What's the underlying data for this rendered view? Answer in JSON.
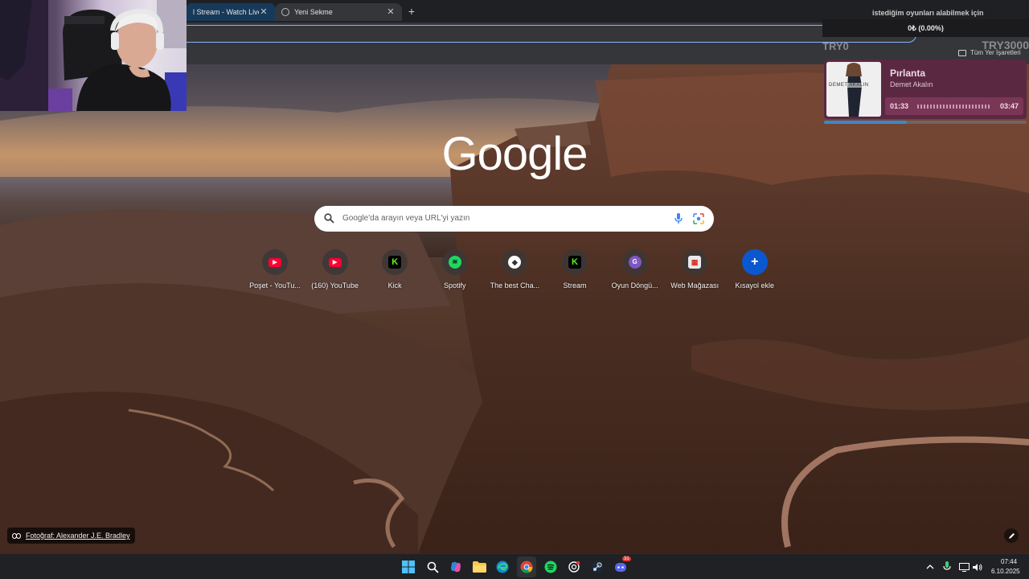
{
  "browser": {
    "tabs": [
      {
        "title": "l Stream - Watch Live o",
        "active": false
      },
      {
        "title": "Yeni Sekme",
        "active": true
      }
    ],
    "new_tab_symbol": "+",
    "close_symbol": "✕",
    "bookmarks_all_label": "Tüm Yer İşaretleri"
  },
  "stream_overlay": {
    "goal_text": "istediğim oyunları alabilmek için",
    "goal_progress": "0₺ (0.00%)",
    "goal_min_label": "TRY0",
    "goal_max_label": "TRY3000",
    "goal_fraction": 0.0
  },
  "music": {
    "title": "Pırlanta",
    "artist": "Demet Akalın",
    "elapsed": "01:33",
    "total": "03:47",
    "progress": 0.41,
    "album_text": "DEMET AKALIN"
  },
  "new_tab": {
    "logo_text": "Google",
    "search_placeholder": "Google'da arayın veya URL'yi yazın",
    "shortcuts": [
      {
        "label": "Poşet - YouTu...",
        "icon": "youtube-icon",
        "color": "#ff0033"
      },
      {
        "label": "(160) YouTube",
        "icon": "youtube-icon",
        "color": "#ff0033"
      },
      {
        "label": "Kick",
        "icon": "kick-icon",
        "color": "#53fc18"
      },
      {
        "label": "Spotify",
        "icon": "spotify-icon",
        "color": "#1ed760"
      },
      {
        "label": "The best Cha...",
        "icon": "tag-icon",
        "color": "#ffffff"
      },
      {
        "label": "Stream",
        "icon": "kick-icon",
        "color": "#53fc18"
      },
      {
        "label": "Oyun Döngü...",
        "icon": "letter-g-icon",
        "color": "#7e57c2"
      },
      {
        "label": "Web Mağazası",
        "icon": "web-store-icon",
        "color": "#e8eaed"
      },
      {
        "label": "Kısayol ekle",
        "icon": "plus-icon",
        "color": "#0b57d0"
      }
    ],
    "photo_credit": "Fotoğraf: Alexander J.E. Bradley"
  },
  "taskbar": {
    "time": "07:44",
    "date": "6.10.2025",
    "apps": [
      "windows-start-icon",
      "search-icon",
      "copilot-icon",
      "file-explorer-icon",
      "edge-icon",
      "chrome-icon",
      "spotify-icon",
      "chatgpt-icon",
      "steam-icon",
      "discord-icon"
    ],
    "discord_badge": "31"
  },
  "colors": {
    "accent": "#8ab4f8",
    "music_card": "#5b2842",
    "taskbar": "#202124"
  }
}
